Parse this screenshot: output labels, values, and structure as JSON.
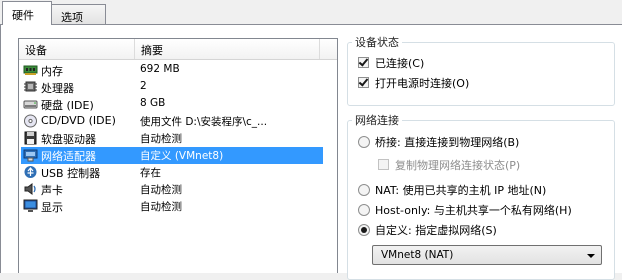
{
  "tabs": [
    "硬件",
    "选项"
  ],
  "device_list": {
    "columns": [
      "设备",
      "摘要"
    ],
    "rows": [
      {
        "device": "内存",
        "summary": "692 MB",
        "icon": "memory-icon"
      },
      {
        "device": "处理器",
        "summary": "2",
        "icon": "processor-icon"
      },
      {
        "device": "硬盘 (IDE)",
        "summary": "8 GB",
        "icon": "hard-disk-icon"
      },
      {
        "device": "CD/DVD (IDE)",
        "summary": "使用文件 D:\\安装程序\\c_...",
        "icon": "cd-dvd-icon"
      },
      {
        "device": "软盘驱动器",
        "summary": "自动检测",
        "icon": "floppy-icon"
      },
      {
        "device": "网络适配器",
        "summary": "自定义 (VMnet8)",
        "icon": "network-adapter-icon",
        "selected": true
      },
      {
        "device": "USB 控制器",
        "summary": "存在",
        "icon": "usb-icon"
      },
      {
        "device": "声卡",
        "summary": "自动检测",
        "icon": "sound-card-icon"
      },
      {
        "device": "显示",
        "summary": "自动检测",
        "icon": "display-icon"
      }
    ]
  },
  "device_status": {
    "title": "设备状态",
    "connected": {
      "label": "已连接(C)",
      "checked": true
    },
    "connect_at_power_on": {
      "label": "打开电源时连接(O)",
      "checked": true
    }
  },
  "network_connection": {
    "title": "网络连接",
    "bridged": {
      "label": "桥接: 直接连接到物理网络(B)",
      "checked": false
    },
    "replicate_state": {
      "label": "复制物理网络连接状态(P)",
      "checked": false,
      "disabled": true
    },
    "nat": {
      "label": "NAT: 使用已共享的主机 IP 地址(N)",
      "checked": false
    },
    "host_only": {
      "label": "Host-only: 与主机共享一个私有网络(H)",
      "checked": false
    },
    "custom": {
      "label": "自定义: 指定虚拟网络(S)",
      "checked": true
    },
    "custom_network_value": "VMnet8 (NAT)"
  },
  "colors": {
    "selection": "#3399ff",
    "border": "#828790"
  }
}
